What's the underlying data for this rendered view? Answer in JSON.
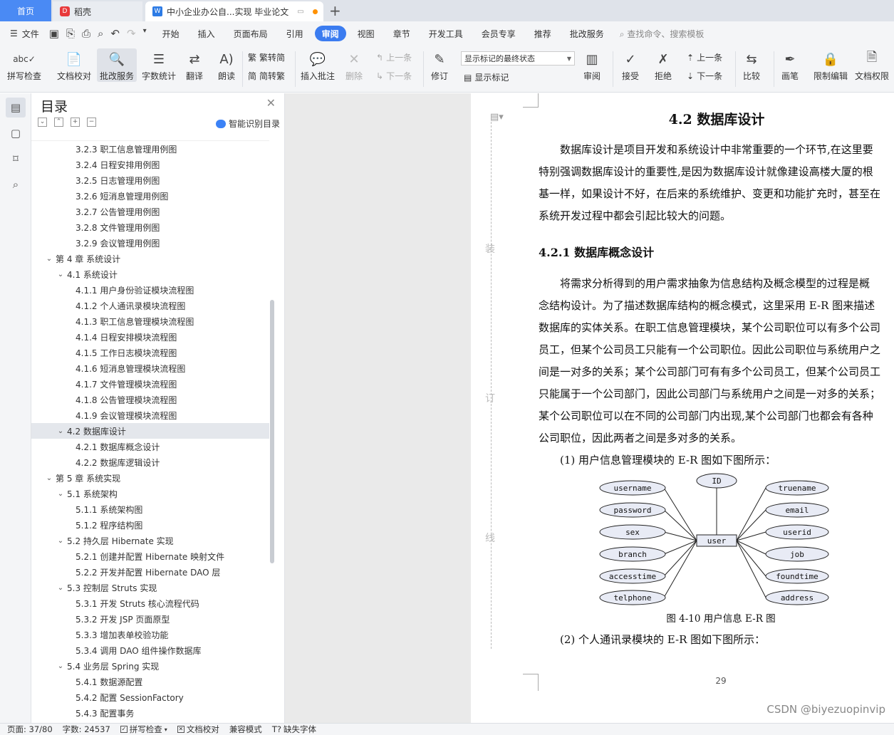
{
  "tabs": {
    "home": "首页",
    "daoke": "稻壳",
    "doc": "中小企业办公自...实现 毕业论文"
  },
  "menu": {
    "file": "文件",
    "items": [
      "开始",
      "插入",
      "页面布局",
      "引用",
      "审阅",
      "视图",
      "章节",
      "开发工具",
      "会员专享",
      "推荐",
      "批改服务"
    ],
    "active_index": 4,
    "search": "查找命令、搜索模板"
  },
  "ribbon": {
    "spellcheck": "拼写检查",
    "doccheck": "文档校对",
    "correction": "批改服务",
    "wordcount": "字数统计",
    "translate": "翻译",
    "read": "朗读",
    "trad_to_simp": "繁转简",
    "simp_to_trad": "简转繁",
    "insert_comment": "插入批注",
    "delete": "删除",
    "prev": "上一条",
    "next": "下一条",
    "revise": "修订",
    "markup_state": "显示标记的最终状态",
    "show_markup": "显示标记",
    "review": "审阅",
    "accept": "接受",
    "reject": "拒绝",
    "prev2": "上一条",
    "next2": "下一条",
    "compare": "比较",
    "pen": "画笔",
    "restrict_edit": "限制编辑",
    "doc_perm": "文档权限"
  },
  "toc": {
    "title": "目录",
    "smart": "智能识别目录",
    "items": [
      {
        "level": 3,
        "text": "3.2.3  职工信息管理用例图"
      },
      {
        "level": 3,
        "text": "3.2.4  日程安排用例图"
      },
      {
        "level": 3,
        "text": "3.2.5  日志管理用例图"
      },
      {
        "level": 3,
        "text": "3.2.6  短消息管理用例图"
      },
      {
        "level": 3,
        "text": "3.2.7  公告管理用例图"
      },
      {
        "level": 3,
        "text": "3.2.8  文件管理用例图"
      },
      {
        "level": 3,
        "text": "3.2.9  会议管理用例图"
      },
      {
        "level": 1,
        "text": "第 4 章  系统设计"
      },
      {
        "level": 2,
        "text": "4.1  系统设计"
      },
      {
        "level": 3,
        "text": "4.1.1  用户身份验证模块流程图"
      },
      {
        "level": 3,
        "text": "4.1.2  个人通讯录模块流程图"
      },
      {
        "level": 3,
        "text": "4.1.3  职工信息管理模块流程图"
      },
      {
        "level": 3,
        "text": "4.1.4  日程安排模块流程图"
      },
      {
        "level": 3,
        "text": "4.1.5  工作日志模块流程图"
      },
      {
        "level": 3,
        "text": "4.1.6  短消息管理模块流程图"
      },
      {
        "level": 3,
        "text": "4.1.7  文件管理模块流程图"
      },
      {
        "level": 3,
        "text": "4.1.8  公告管理模块流程图"
      },
      {
        "level": 3,
        "text": "4.1.9  会议管理模块流程图"
      },
      {
        "level": 2,
        "text": "4.2  数据库设计",
        "selected": true
      },
      {
        "level": 3,
        "text": "4.2.1  数据库概念设计"
      },
      {
        "level": 3,
        "text": "4.2.2  数据库逻辑设计"
      },
      {
        "level": 1,
        "text": "第 5 章  系统实现"
      },
      {
        "level": 2,
        "text": "5.1  系统架构"
      },
      {
        "level": 3,
        "text": "5.1.1  系统架构图"
      },
      {
        "level": 3,
        "text": "5.1.2  程序结构图"
      },
      {
        "level": 2,
        "text": "5.2  持久层 Hibernate 实现"
      },
      {
        "level": 3,
        "text": "5.2.1  创建并配置 Hibernate 映射文件"
      },
      {
        "level": 3,
        "text": "5.2.2  开发并配置 Hibernate DAO 层"
      },
      {
        "level": 2,
        "text": "5.3  控制层 Struts 实现"
      },
      {
        "level": 3,
        "text": "5.3.1  开发 Struts 核心流程代码"
      },
      {
        "level": 3,
        "text": "5.3.2  开发 JSP 页面原型"
      },
      {
        "level": 3,
        "text": "5.3.3  增加表单校验功能"
      },
      {
        "level": 3,
        "text": "5.3.4  调用 DAO 组件操作数据库"
      },
      {
        "level": 2,
        "text": "5.4  业务层 Spring 实现"
      },
      {
        "level": 3,
        "text": "5.4.1  数据源配置"
      },
      {
        "level": 3,
        "text": "5.4.2  配置 SessionFactory"
      },
      {
        "level": 3,
        "text": "5.4.3  配置事务"
      }
    ]
  },
  "doc": {
    "heading": "4.2  数据库设计",
    "para1": [
      "数据库设计是项目开发和系统设计中非常重要的一个环节,在这里要",
      "特别强调数据库设计的重要性,是因为数据库设计就像建设高楼大厦的根",
      "基一样，如果设计不好，在后来的系统维护、变更和功能扩充时，甚至在",
      "系统开发过程中都会引起比较大的问题。"
    ],
    "subheading": "4.2.1  数据库概念设计",
    "para2": [
      "将需求分析得到的用户需求抽象为信息结构及概念模型的过程是概",
      "念结构设计。为了描述数据库结构的概念模式，这里采用 E-R 图来描述",
      "数据库的实体关系。在职工信息管理模块，某个公司职位可以有多个公司",
      "员工，但某个公司员工只能有一个公司职位。因此公司职位与系统用户之",
      "间是一对多的关系；某个公司部门可有有多个公司员工，但某个公司员工",
      "只能属于一个公司部门，因此公司部门与系统用户之间是一对多的关系；",
      "某个公司职位可以在不同的公司部门内出现,某个公司部门也都会有各种",
      "公司职位，因此两者之间是多对多的关系。"
    ],
    "item1": "(1)  用户信息管理模块的 E-R 图如下图所示：",
    "er": {
      "center": "user",
      "top": "ID",
      "left": [
        "username",
        "password",
        "sex",
        "branch",
        "accesstime",
        "telphone"
      ],
      "right": [
        "truename",
        "email",
        "userid",
        "job",
        "foundtime",
        "address"
      ]
    },
    "caption": "图 4-10 用户信息 E-R 图",
    "item2": "(2)  个人通讯录模块的 E-R 图如下图所示：",
    "pagenum": "29",
    "binding": [
      "装",
      "订",
      "线"
    ]
  },
  "status": {
    "page": "页面: 37/80",
    "words": "字数: 24537",
    "spell": "拼写检查",
    "proof": "文档校对",
    "compat": "兼容模式",
    "font": "缺失字体"
  },
  "watermark": "CSDN @biyezuopinvip"
}
